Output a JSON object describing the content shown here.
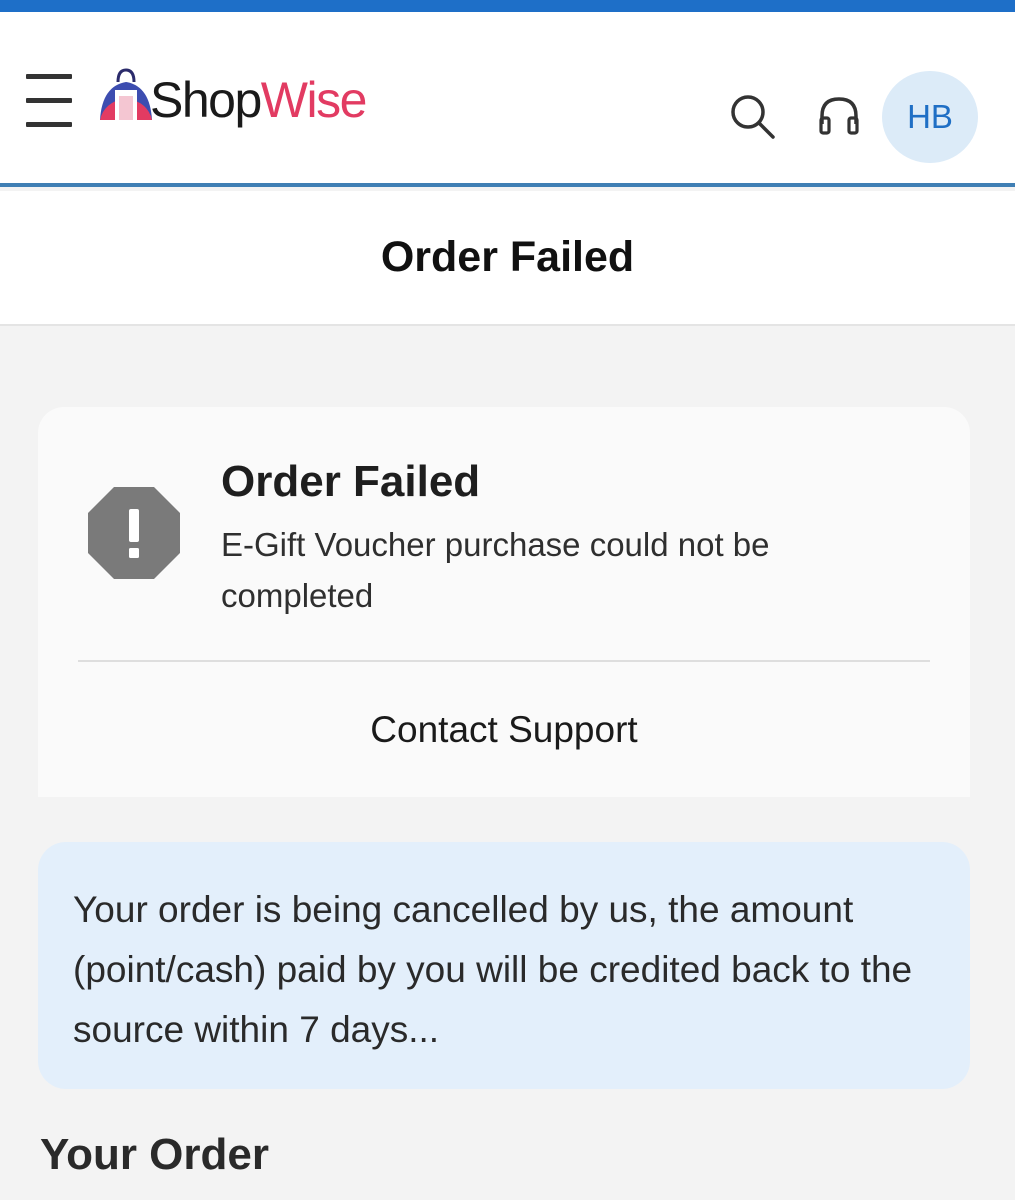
{
  "header": {
    "logo_part1": "Shop",
    "logo_part2": "Wise",
    "avatar_initials": "HB"
  },
  "page": {
    "title": "Order Failed"
  },
  "status_card": {
    "title": "Order Failed",
    "description": "E-Gift Voucher purchase could not be completed",
    "action_label": "Contact Support"
  },
  "info": {
    "message": "Your order is being cancelled by us, the amount (point/cash) paid by you will be credited back to the source within 7 days..."
  },
  "section": {
    "your_order": "Your Order"
  },
  "icons": {
    "menu": "hamburger-menu-icon",
    "search": "search-icon",
    "support": "headphones-icon",
    "status": "alert-octagon-icon"
  },
  "colors": {
    "brand_blue": "#1e6fc8",
    "logo_accent": "#e23b62",
    "info_bg": "#e3effb",
    "alert_icon": "#7a7a7a"
  }
}
